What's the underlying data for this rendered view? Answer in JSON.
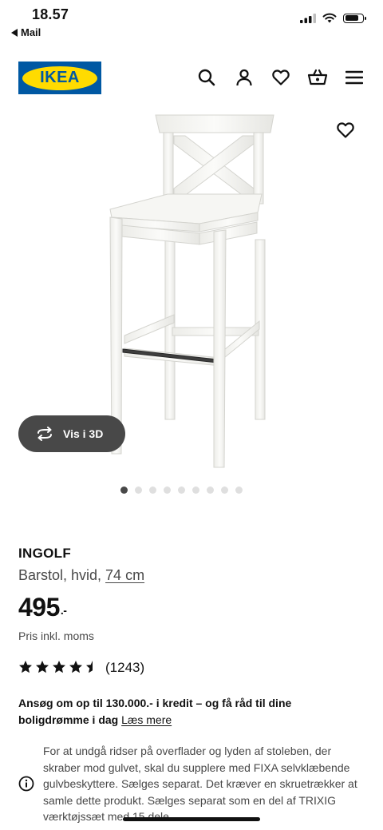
{
  "status_bar": {
    "time": "18.57",
    "back_label": "Mail",
    "battery_level": 0.8
  },
  "header": {
    "logo_text": "IKEA",
    "icons": [
      "search-icon",
      "user-icon",
      "heart-icon",
      "basket-icon",
      "menu-icon"
    ]
  },
  "gallery": {
    "view_3d_label": "Vis i 3D",
    "dot_count": 9,
    "active_index": 0
  },
  "product": {
    "name": "INGOLF",
    "description_prefix": "Barstol, hvid, ",
    "description_size": "74 cm",
    "price": "495",
    "price_suffix": ".-",
    "vat_note": "Pris inkl. moms",
    "rating": 4.5,
    "rating_max": 5,
    "review_count": "(1243)"
  },
  "credit": {
    "text": "Ansøg om op til 130.000.- i kredit – og få råd til dine boligdrømme i dag ",
    "link": "Læs mere"
  },
  "notice": {
    "text": "For at undgå ridser på overflader og lyden af stoleben, der skraber mod gulvet, skal du supplere med FIXA selvklæbende gulvbeskyttere. Sælges separat. Det kræver en skruetrækker at samle dette produkt. Sælges separat som en del af TRIXIG værktøjssæt med 15 dele."
  },
  "colors": {
    "ikea_blue": "#0058a3",
    "ikea_yellow": "#ffdb00",
    "dark_button": "#484848"
  }
}
